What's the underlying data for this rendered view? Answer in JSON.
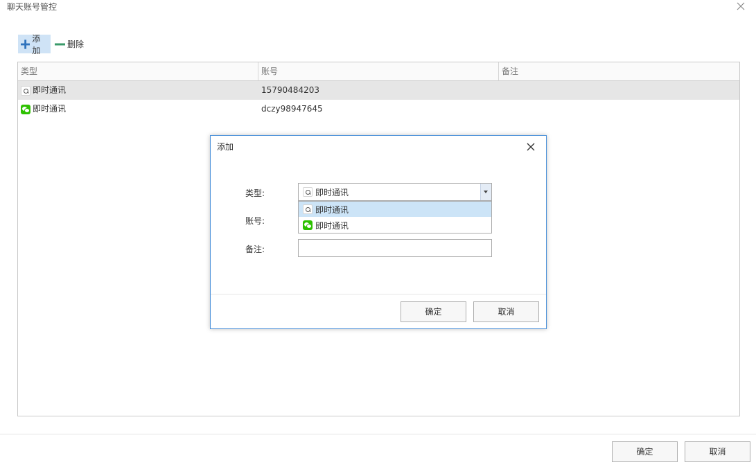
{
  "window": {
    "title": "聊天账号管控"
  },
  "toolbar": {
    "add_label": "添加",
    "delete_label": "删除"
  },
  "table": {
    "columns": [
      "类型",
      "账号",
      "备注"
    ],
    "rows": [
      {
        "type": "即时通讯",
        "icon": "qq-icon",
        "account": "15790484203",
        "note": "",
        "selected": true
      },
      {
        "type": "即时通讯",
        "icon": "wechat-icon",
        "account": "dczy98947645",
        "note": ""
      }
    ]
  },
  "footer": {
    "ok_label": "确定",
    "cancel_label": "取消"
  },
  "dialog": {
    "title": "添加",
    "type_label": "类型:",
    "account_label": "账号:",
    "note_label": "备注:",
    "type_selected": "即时通讯",
    "type_options": [
      {
        "label": "即时通讯",
        "icon": "qq-icon",
        "highlighted": true
      },
      {
        "label": "即时通讯",
        "icon": "wechat-icon"
      }
    ],
    "account_value": "",
    "note_value": "",
    "ok_label": "确定",
    "cancel_label": "取消"
  },
  "colors": {
    "accent": "#4a90d9",
    "selection": "#e6e6e6",
    "option_highlight": "#cce4f7",
    "add_button_bg": "#cfe3f6",
    "plus_icon": "#2f73bd",
    "minus_icon": "#3a9a6a"
  }
}
